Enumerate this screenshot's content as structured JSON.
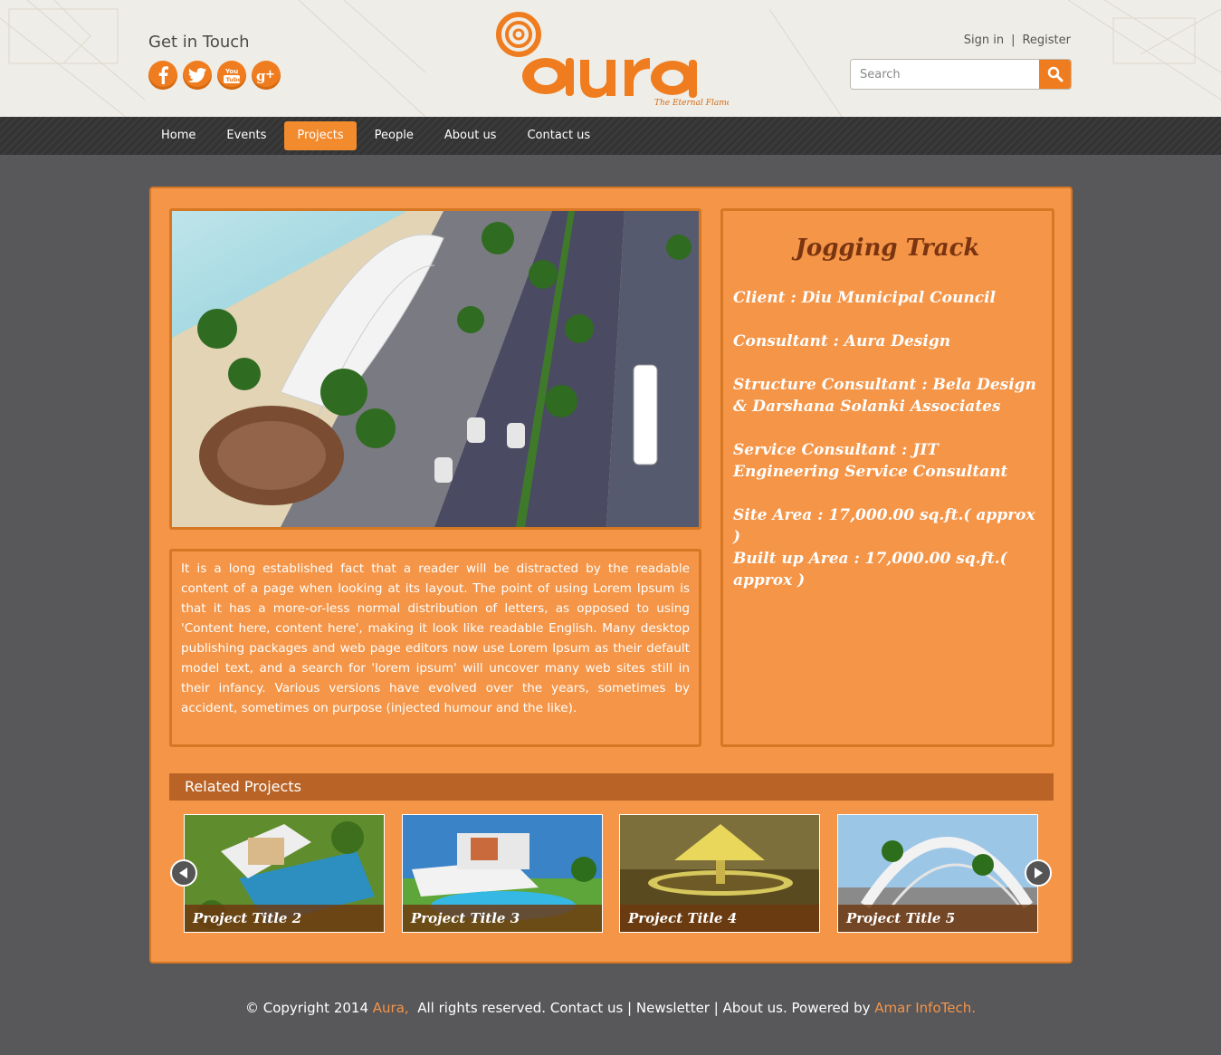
{
  "header": {
    "get_in_touch": "Get in Touch",
    "social_icons": [
      "facebook-icon",
      "twitter-icon",
      "youtube-icon",
      "google-plus-icon"
    ],
    "logo_text": "aura",
    "logo_tagline": "The Eternal Flame",
    "sign_in": "Sign in",
    "separator": "|",
    "register": "Register",
    "search_placeholder": "Search"
  },
  "nav": {
    "items": [
      "Home",
      "Events",
      "Projects",
      "People",
      "About us",
      "Contact us"
    ],
    "active": "Projects"
  },
  "project": {
    "title": "Jogging Track",
    "client": "Client    : Diu Municipal Council",
    "consultant": "Consultant    : Aura Design",
    "structure_consultant": "Structure Consultant    : Bela Design & Darshana Solanki Associates",
    "service_consultant": "Service Consultant    : JIT Engineering Service Consultant",
    "site_area": "Site Area    : 17,000.00 sq.ft.( approx )",
    "built_up_area": "Built up Area    : 17,000.00 sq.ft.( approx )",
    "description": "It is a long established fact that a reader will be distracted by the readable content of a page when looking at its layout. The point of using Lorem Ipsum is that it has a more-or-less normal distribution of letters, as opposed to using 'Content here, content here', making it look like readable English. Many desktop publishing packages and web page editors now use Lorem Ipsum as their default model text, and a search for 'lorem ipsum' will uncover many web sites still in their infancy. Various versions have evolved over the years, sometimes by accident, sometimes on purpose (injected humour and the like)."
  },
  "related": {
    "heading": "Related Projects",
    "items": [
      "Project Title 2",
      "Project Title 3",
      "Project Title 4",
      "Project Title 5"
    ]
  },
  "footer": {
    "copyright": "© Copyright 2014 ",
    "brand": "Aura,",
    "rest": "  All rights reserved. Contact us | Newsletter | About us. Powered by ",
    "powered_by": "Amar InfoTech."
  },
  "colors": {
    "accent": "#ef7d1f",
    "panel": "#f49548",
    "panel_border": "#d67724",
    "background": "#58575a"
  }
}
